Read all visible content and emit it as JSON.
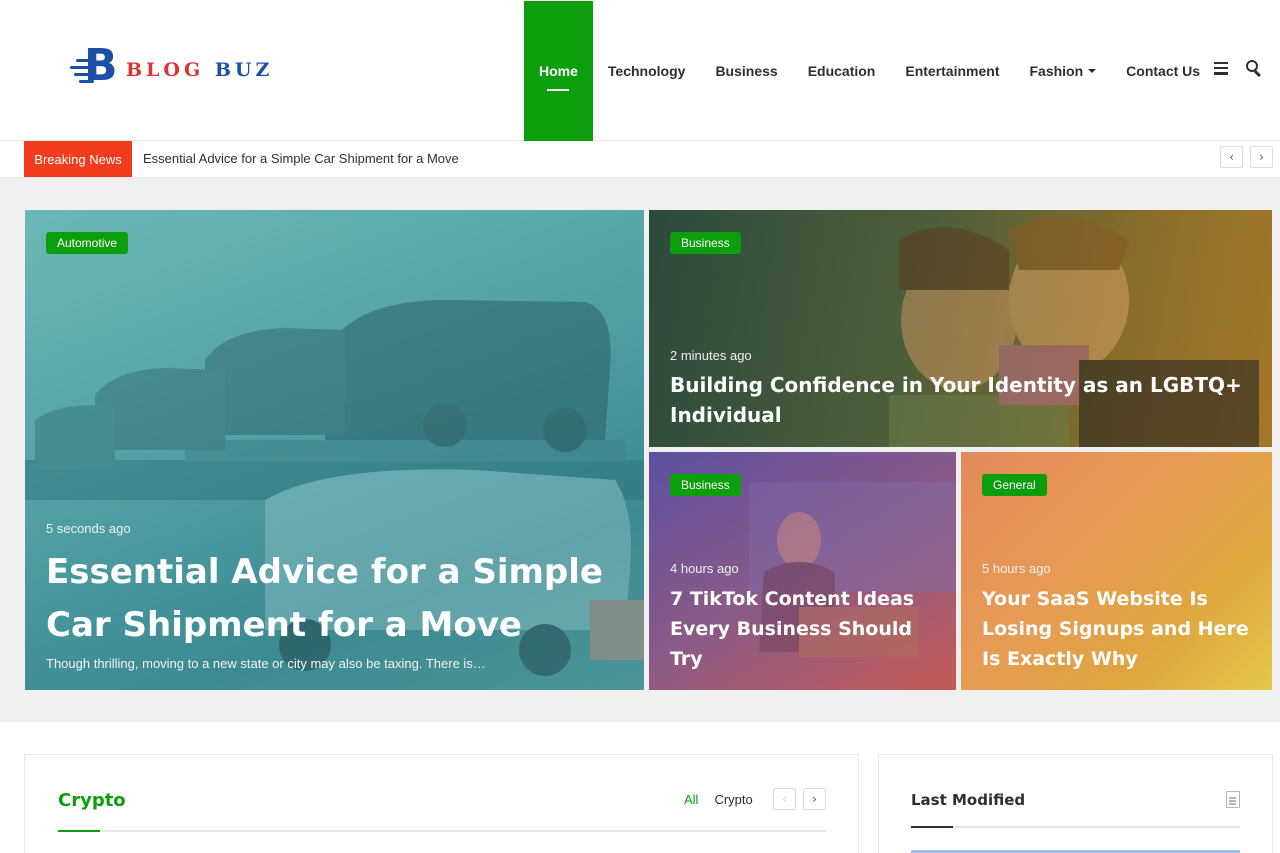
{
  "logo": {
    "part1": "BLOG",
    "part2": "BUZ"
  },
  "nav": {
    "items": [
      "Home",
      "Technology",
      "Business",
      "Education",
      "Entertainment",
      "Fashion",
      "Contact Us"
    ]
  },
  "ticker": {
    "label": "Breaking News",
    "headline": "Essential Advice for a Simple Car Shipment for a Move",
    "prev": "‹",
    "next": "›"
  },
  "featured": [
    {
      "category": "Automotive",
      "time": "5 seconds ago",
      "title": "Essential Advice for a Simple Car Shipment for a Move",
      "excerpt": "Though thrilling, moving to a new state or city may also be taxing. There is…"
    },
    {
      "category": "Business",
      "time": "2 minutes ago",
      "title": "Building Confidence in Your Identity as an LGBTQ+ Individual"
    },
    {
      "category": "Business",
      "time": "4 hours ago",
      "title": "7 TikTok Content Ideas Every Business Should Try"
    },
    {
      "category": "General",
      "time": "5 hours ago",
      "title": "Your SaaS Website Is Losing Signups and Here Is Exactly Why"
    }
  ],
  "crypto": {
    "title": "Crypto",
    "tabs": [
      "All",
      "Crypto"
    ],
    "prev": "‹",
    "next": "›"
  },
  "last_modified": {
    "title": "Last Modified"
  },
  "colors": {
    "accent": "#0c9e0c",
    "breaking": "#f13c1d",
    "brand_blue": "#1c4fa8",
    "brand_red": "#e03131"
  },
  "icons": [
    "menu-icon",
    "search-icon",
    "document-icon"
  ]
}
